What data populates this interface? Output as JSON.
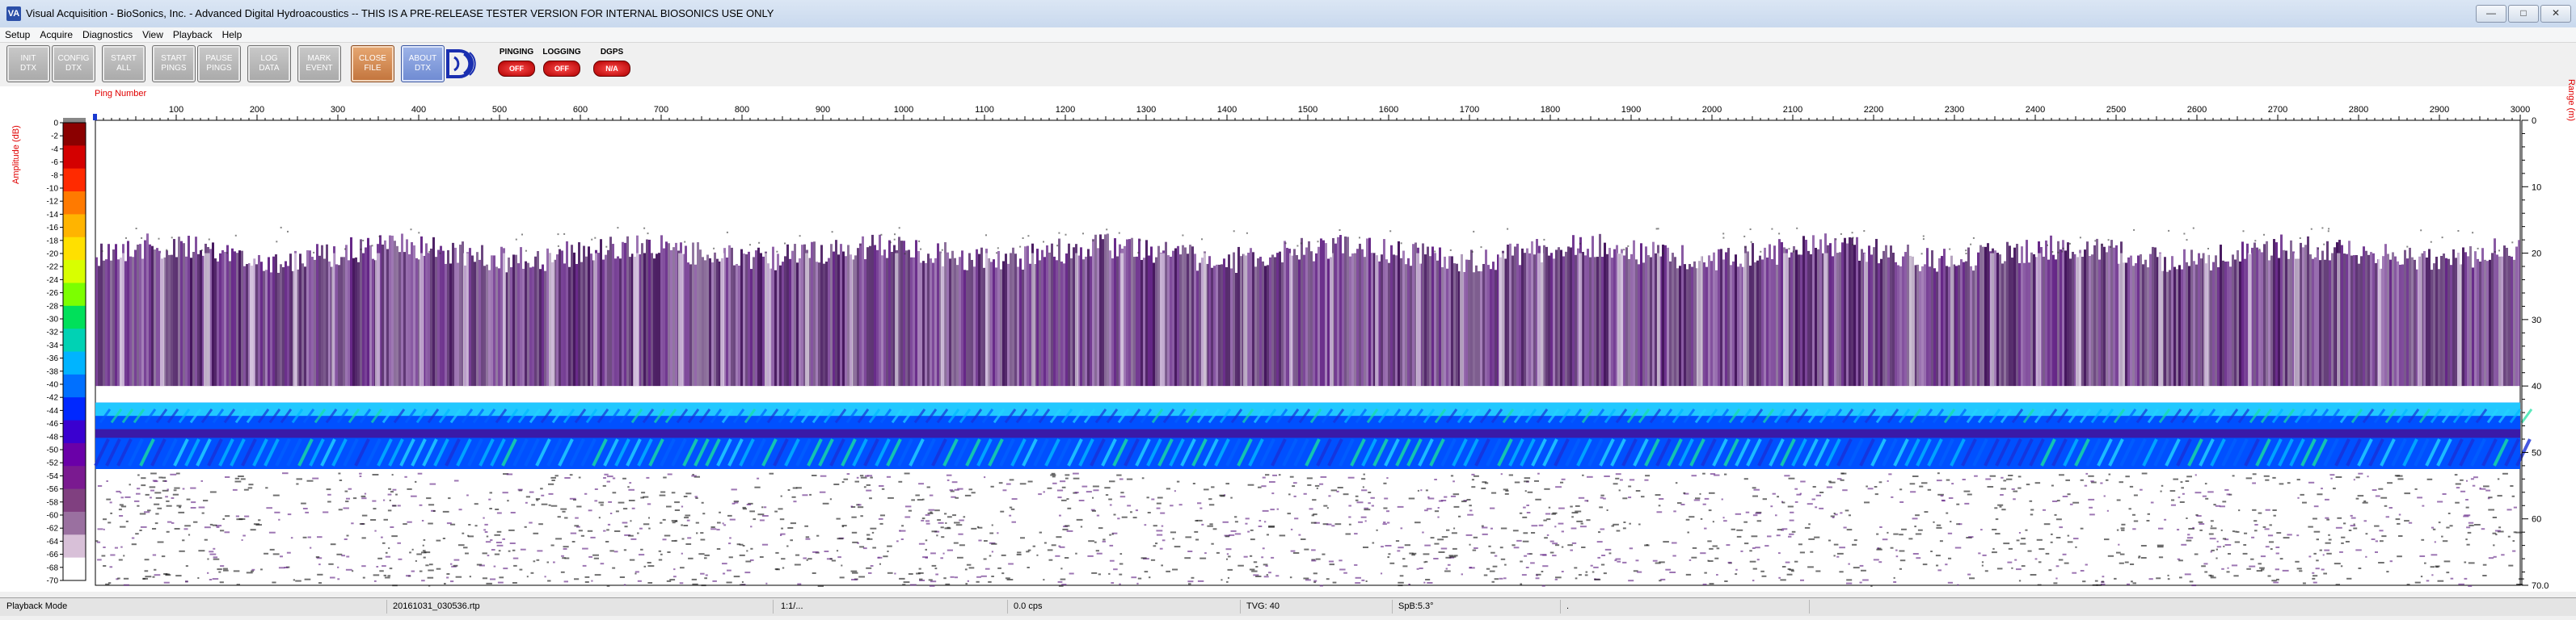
{
  "window": {
    "icon_text": "VA",
    "title": "Visual Acquisition  -  BioSonics, Inc.  -  Advanced Digital Hydroacoustics  -- THIS IS A PRE-RELEASE TESTER VERSION FOR INTERNAL BIOSONICS USE ONLY",
    "minimize": "—",
    "maximize": "□",
    "close": "✕"
  },
  "menu": {
    "setup": "Setup",
    "acquire": "Acquire",
    "diagnostics": "Diagnostics",
    "view": "View",
    "playback": "Playback",
    "help": "Help"
  },
  "toolbar": {
    "init_dtx": "INIT\nDTX",
    "config_dtx": "CONFIG\nDTX",
    "start_all": "START\nALL",
    "start_pings": "START\nPINGS",
    "pause_pings": "PAUSE\nPINGS",
    "log_data": "LOG\nDATA",
    "mark_event": "MARK\nEVENT",
    "close_file": "CLOSE\nFILE",
    "about_dtx": "ABOUT\nDTX",
    "pinging_label": "PINGING",
    "pinging_state": "OFF",
    "logging_label": "LOGGING",
    "logging_state": "OFF",
    "dgps_label": "DGPS",
    "dgps_state": "N/A"
  },
  "plot": {
    "ping_axis_label": "Ping Number",
    "amplitude_axis_label": "Amplitude (dB)",
    "range_axis_label": "Range (m)",
    "ping_ticks": [
      100,
      200,
      300,
      400,
      500,
      600,
      700,
      800,
      900,
      1000,
      1100,
      1200,
      1300,
      1400,
      1500,
      1600,
      1700,
      1800,
      1900,
      2000,
      2100,
      2200,
      2300,
      2400,
      2500,
      2600,
      2700,
      2800,
      2900,
      3000
    ],
    "ping_range": [
      0,
      3000
    ],
    "range_ticks": [
      "0",
      "10",
      "20",
      "30",
      "40",
      "50",
      "60",
      "70.0"
    ],
    "range_values": [
      0,
      10,
      20,
      30,
      40,
      50,
      60,
      70
    ],
    "range_max": 70,
    "amplitude_ticks": [
      "0",
      "-2",
      "-4",
      "-6",
      "-8",
      "-10",
      "-12",
      "-14",
      "-16",
      "-18",
      "-20",
      "-22",
      "-24",
      "-26",
      "-28",
      "-30",
      "-32",
      "-34",
      "-36",
      "-38",
      "-40",
      "-42",
      "-44",
      "-46",
      "-48",
      "-50",
      "-52",
      "-54",
      "-56",
      "-58",
      "-60",
      "-62",
      "-64",
      "-66",
      "-68",
      "-70"
    ],
    "colorbar_colors": [
      "#8b0000",
      "#d40000",
      "#ff2a00",
      "#ff7a00",
      "#ffb400",
      "#ffe000",
      "#d8ff00",
      "#7cff00",
      "#00e05a",
      "#00d2b4",
      "#00b4ff",
      "#0070ff",
      "#0028ff",
      "#3a00d0",
      "#6a00a8",
      "#7a1a90",
      "#804080",
      "#9a70a0",
      "#d8c0d8",
      "#ffffff"
    ],
    "echo_colors": {
      "weak": "#3b0a55",
      "mid": "#5c1a80",
      "speckle": "#111111",
      "layer": [
        "#00b8ff",
        "#0060ff",
        "#22d6ff",
        "#18e0a0",
        "#1a30d8"
      ]
    }
  },
  "status": {
    "mode": "Playback Mode",
    "file": "20161031_030536.rtp",
    "ratio": "1:1/...",
    "rate": "0.0 cps",
    "tvg": "TVG: 40",
    "spb": "SpB:5.3°",
    "blank": "."
  }
}
